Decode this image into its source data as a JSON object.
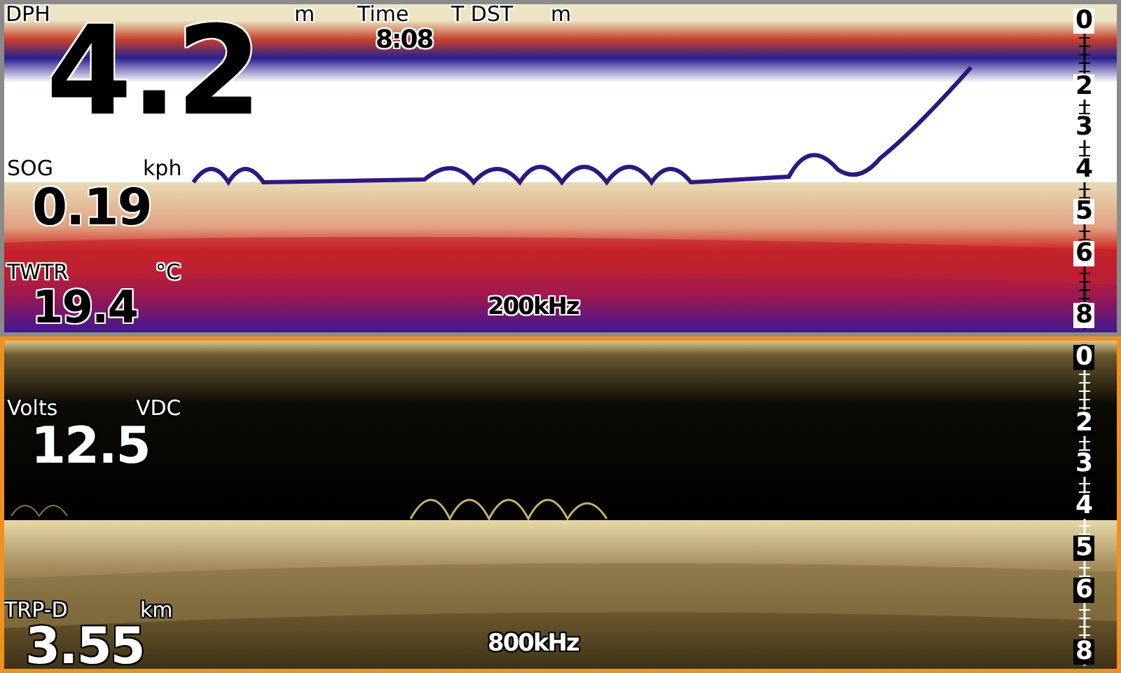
{
  "panels": [
    {
      "kind": "color",
      "selected": false,
      "frequency": "200kHz",
      "scale": [
        "0",
        "2",
        "3",
        "4",
        "5",
        "6",
        "8"
      ],
      "fields": [
        {
          "label": "DPH",
          "unit": "m",
          "value": "4.2"
        },
        {
          "label": "Time",
          "value": "8:08"
        },
        {
          "label": "T DST",
          "unit": "m"
        },
        {
          "label": "SOG",
          "unit": "kph",
          "value": "0.19"
        },
        {
          "label": "TWTR",
          "unit": "°C",
          "value": "19.4"
        }
      ]
    },
    {
      "kind": "amber",
      "selected": true,
      "frequency": "800kHz",
      "scale": [
        "0",
        "2",
        "3",
        "4",
        "5",
        "6",
        "8"
      ],
      "fields": [
        {
          "label": "Volts",
          "unit": "VDC",
          "value": "12.5"
        },
        {
          "label": "TRP-D",
          "unit": "km",
          "value": "3.55"
        }
      ]
    }
  ]
}
